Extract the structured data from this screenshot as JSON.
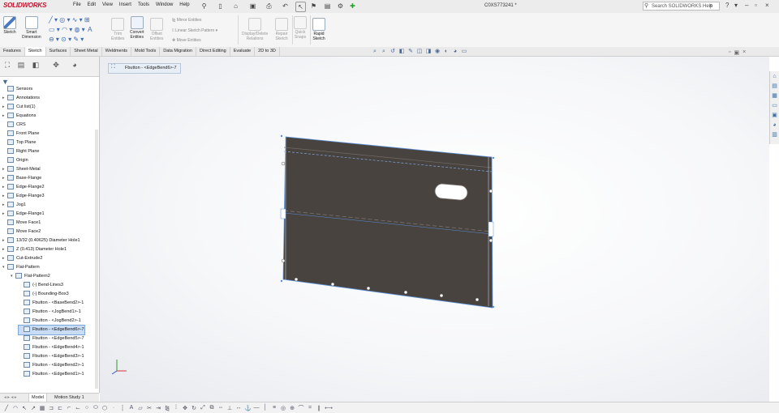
{
  "app": {
    "logo": "SOLIDWORKS",
    "menu": [
      "File",
      "Edit",
      "View",
      "Insert",
      "Tools",
      "Window",
      "Help"
    ],
    "document_title": "C0XS773241 *",
    "search_placeholder": "Search SOLIDWORKS Help"
  },
  "ribbon": {
    "sketch": "Sketch",
    "smart_dimension": [
      "Smart",
      "Dimension"
    ],
    "trim_entities": [
      "Trim",
      "Entities"
    ],
    "convert_entities": [
      "Convert",
      "Entities"
    ],
    "offset_entities": [
      "Offset",
      "Entities"
    ],
    "mirror_entities": "Mirror Entities",
    "linear_sketch_pattern": "Linear Sketch Pattern",
    "move_entities": "Move Entities",
    "display_delete_relations": [
      "Display/Delete",
      "Relations"
    ],
    "repair_sketch": [
      "Repair",
      "Sketch"
    ],
    "quick_snaps": [
      "Quick",
      "Snaps"
    ],
    "rapid_sketch": [
      "Rapid",
      "Sketch"
    ]
  },
  "command_tabs": [
    "Features",
    "Sketch",
    "Surfaces",
    "Sheet Metal",
    "Weldments",
    "Mold Tools",
    "Data Migration",
    "Direct Editing",
    "Evaluate",
    "2D to 3D"
  ],
  "active_command_tab": "Sketch",
  "breadcrumb": "Fbutton - <EdgeBend6>-7",
  "tree": [
    {
      "label": "Sensors",
      "depth": 0,
      "arrow": ""
    },
    {
      "label": "Annotations",
      "depth": 0,
      "arrow": "▸"
    },
    {
      "label": "Cut list(1)",
      "depth": 0,
      "arrow": "▸"
    },
    {
      "label": "Equations",
      "depth": 0,
      "arrow": "▸"
    },
    {
      "label": "CRS",
      "depth": 0,
      "arrow": ""
    },
    {
      "label": "Front Plane",
      "depth": 0,
      "arrow": ""
    },
    {
      "label": "Top Plane",
      "depth": 0,
      "arrow": ""
    },
    {
      "label": "Right Plane",
      "depth": 0,
      "arrow": ""
    },
    {
      "label": "Origin",
      "depth": 0,
      "arrow": ""
    },
    {
      "label": "Sheet-Metal",
      "depth": 0,
      "arrow": "▸"
    },
    {
      "label": "Base-Flange",
      "depth": 0,
      "arrow": "▸"
    },
    {
      "label": "Edge-Flange2",
      "depth": 0,
      "arrow": "▸"
    },
    {
      "label": "Edge-Flange3",
      "depth": 0,
      "arrow": "▸"
    },
    {
      "label": "Jog1",
      "depth": 0,
      "arrow": "▸"
    },
    {
      "label": "Edge-Flange1",
      "depth": 0,
      "arrow": "▸"
    },
    {
      "label": "Move Face1",
      "depth": 0,
      "arrow": ""
    },
    {
      "label": "Move Face2",
      "depth": 0,
      "arrow": ""
    },
    {
      "label": "13/32 (0.40625) Diameter Hole1",
      "depth": 0,
      "arrow": "▸"
    },
    {
      "label": "Z (0.413) Diameter Hole1",
      "depth": 0,
      "arrow": "▸"
    },
    {
      "label": "Cut-Extrude2",
      "depth": 0,
      "arrow": "▸"
    },
    {
      "label": "Flat-Pattern",
      "depth": 0,
      "arrow": "▾"
    },
    {
      "label": "Flat-Pattern2",
      "depth": 1,
      "arrow": "▾"
    },
    {
      "label": "(-) Bend-Lines3",
      "depth": 2,
      "arrow": ""
    },
    {
      "label": "(-) Bounding-Box3",
      "depth": 2,
      "arrow": ""
    },
    {
      "label": "Fbutton - <BaseBend2>-1",
      "depth": 2,
      "arrow": ""
    },
    {
      "label": "Fbutton - <JogBend1>-1",
      "depth": 2,
      "arrow": ""
    },
    {
      "label": "Fbutton - <JogBend2>-1",
      "depth": 2,
      "arrow": ""
    },
    {
      "label": "Fbutton - <EdgeBend6>-7",
      "depth": 2,
      "arrow": "",
      "selected": true
    },
    {
      "label": "Fbutton - <EdgeBend5>-7",
      "depth": 2,
      "arrow": ""
    },
    {
      "label": "Fbutton - <EdgeBend4>-1",
      "depth": 2,
      "arrow": ""
    },
    {
      "label": "Fbutton - <EdgeBend3>-1",
      "depth": 2,
      "arrow": ""
    },
    {
      "label": "Fbutton - <EdgeBend2>-1",
      "depth": 2,
      "arrow": ""
    },
    {
      "label": "Fbutton - <EdgeBend1>-1",
      "depth": 2,
      "arrow": ""
    }
  ],
  "bottom_tabs": [
    "Model",
    "Motion Study 1"
  ],
  "active_bottom_tab": "Model",
  "colors": {
    "part": "#48433f",
    "edge": "#5b8fd6",
    "accent": "#c8102e"
  }
}
